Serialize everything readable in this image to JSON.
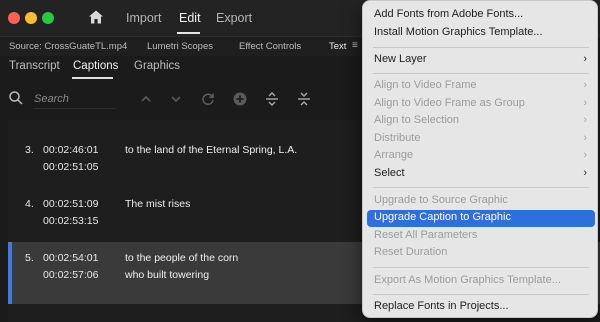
{
  "window": {
    "nav_tabs": [
      "Import",
      "Edit",
      "Export"
    ]
  },
  "panel_tabs": {
    "source": "Source: CrossGuateTL.mp4",
    "lumetri": "Lumetri Scopes",
    "effect": "Effect Controls",
    "text": "Text"
  },
  "sub_tabs": [
    "Transcript",
    "Captions",
    "Graphics"
  ],
  "search": {
    "placeholder": "Search"
  },
  "captions": [
    {
      "num": "3.",
      "start": "00:02:46:01",
      "end": "00:02:51:05",
      "text": [
        "to the land of the Eternal Spring, L.A."
      ],
      "selected": false
    },
    {
      "num": "4.",
      "start": "00:02:51:09",
      "end": "00:02:53:15",
      "text": [
        "The mist rises"
      ],
      "selected": false
    },
    {
      "num": "5.",
      "start": "00:02:54:01",
      "end": "00:02:57:06",
      "text": [
        "to the people of the corn",
        "who built towering"
      ],
      "selected": true
    }
  ],
  "menu": {
    "items": [
      {
        "label": "Add Fonts from Adobe Fonts...",
        "enabled": true
      },
      {
        "label": "Install Motion Graphics Template...",
        "enabled": true
      },
      {
        "label": "New Layer",
        "enabled": true,
        "submenu": true
      },
      {
        "label": "Align to Video Frame",
        "enabled": false,
        "submenu": true
      },
      {
        "label": "Align to Video Frame as Group",
        "enabled": false,
        "submenu": true
      },
      {
        "label": "Align to Selection",
        "enabled": false,
        "submenu": true
      },
      {
        "label": "Distribute",
        "enabled": false,
        "submenu": true
      },
      {
        "label": "Arrange",
        "enabled": false,
        "submenu": true
      },
      {
        "label": "Select",
        "enabled": true,
        "submenu": true
      },
      {
        "label": "Upgrade to Source Graphic",
        "enabled": false
      },
      {
        "label": "Upgrade Caption to Graphic",
        "enabled": true,
        "highlighted": true
      },
      {
        "label": "Reset All Parameters",
        "enabled": false
      },
      {
        "label": "Reset Duration",
        "enabled": false
      },
      {
        "label": "Export As Motion Graphics Template...",
        "enabled": false
      },
      {
        "label": "Replace Fonts in Projects...",
        "enabled": true
      }
    ]
  },
  "colors": {
    "accent": "#2f6fdc",
    "selection_bar": "#3d7be0"
  }
}
